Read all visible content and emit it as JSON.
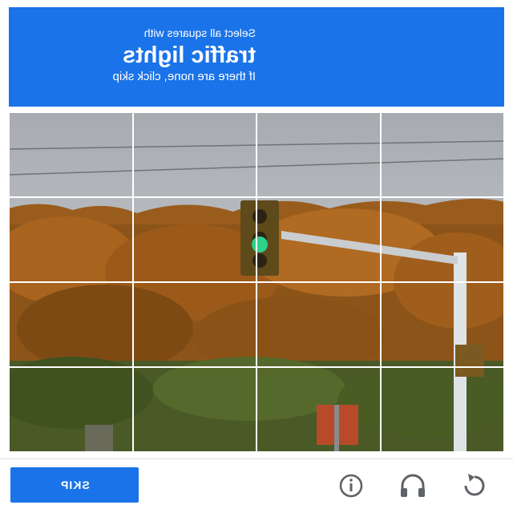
{
  "header": {
    "select_text": "Select all squares with",
    "target_text": "traffic lights",
    "none_text": "If there are none, click skip",
    "background_color": "#1a73e8"
  },
  "grid": {
    "rows": 4,
    "columns": 4,
    "image_description": "street scene with traffic light in front of autumn trees"
  },
  "footer": {
    "skip_label": "SKIP",
    "skip_color": "#1a73e8",
    "icons": [
      "info-icon",
      "headphones-icon",
      "reload-icon"
    ]
  }
}
